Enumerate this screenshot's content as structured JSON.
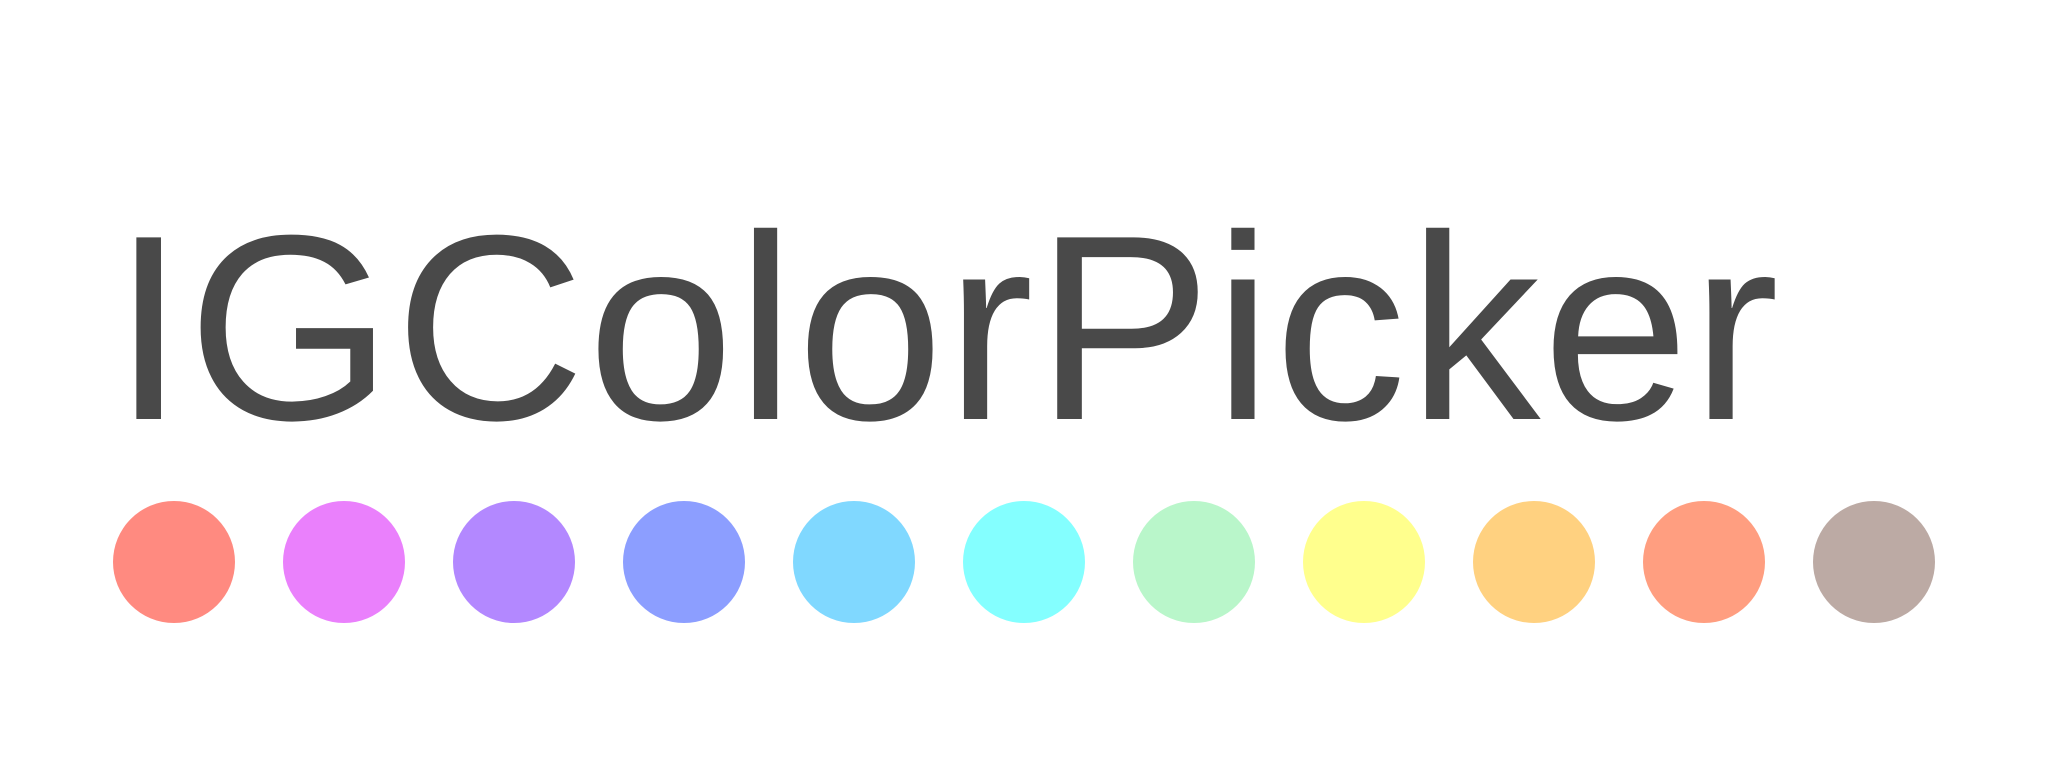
{
  "logo": {
    "wordmark": "IGColorPicker",
    "text_color": "#494949",
    "background": "#ffffff"
  },
  "swatches": [
    {
      "name": "red",
      "color": "#ff8a80"
    },
    {
      "name": "pink",
      "color": "#ea80fc"
    },
    {
      "name": "purple",
      "color": "#b388ff"
    },
    {
      "name": "indigo",
      "color": "#8c9eff"
    },
    {
      "name": "light-blue",
      "color": "#80d8ff"
    },
    {
      "name": "cyan",
      "color": "#84ffff"
    },
    {
      "name": "green",
      "color": "#b9f6ca"
    },
    {
      "name": "yellow",
      "color": "#ffff8d"
    },
    {
      "name": "amber",
      "color": "#ffd180"
    },
    {
      "name": "deep-orange",
      "color": "#ff9e80"
    },
    {
      "name": "brown",
      "color": "#bcaaa4"
    }
  ]
}
